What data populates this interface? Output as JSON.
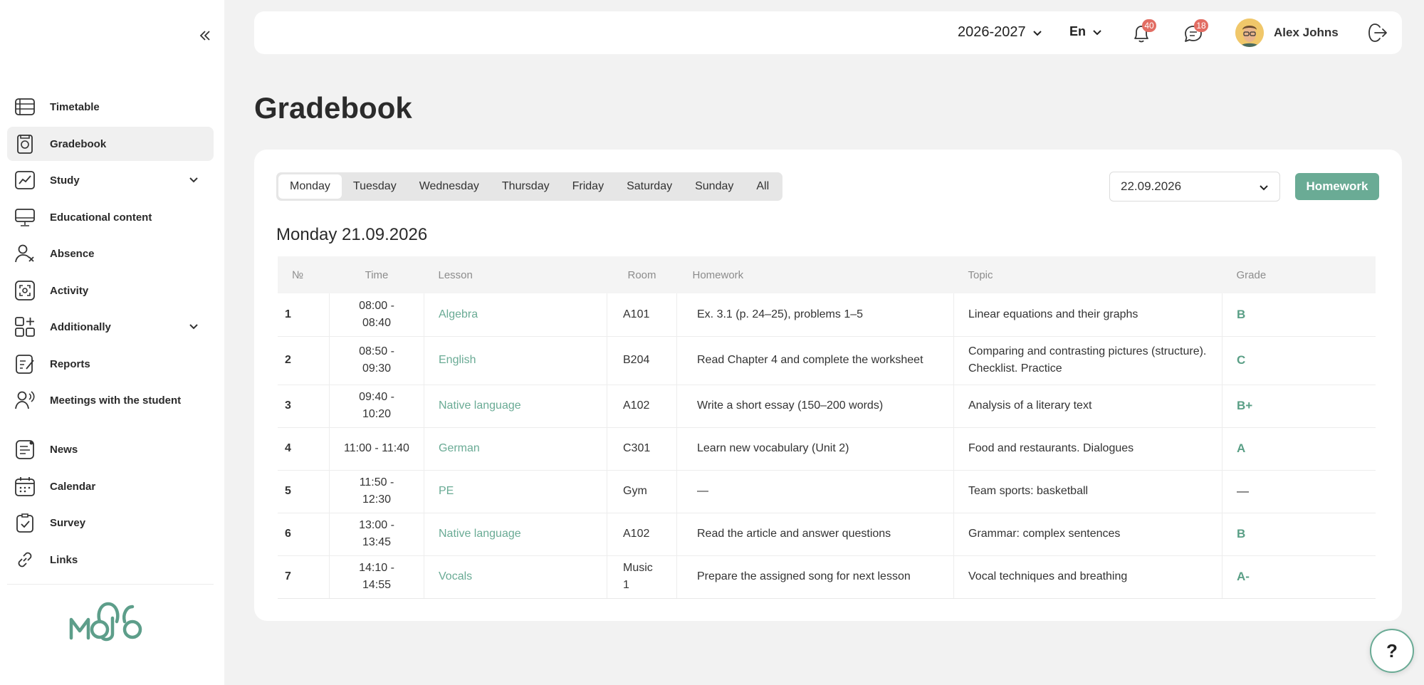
{
  "sidebar": {
    "collapse_icon": "double-chevron-left",
    "items": [
      {
        "label": "Timetable",
        "icon": "timetable-icon",
        "active": false
      },
      {
        "label": "Gradebook",
        "icon": "gradebook-icon",
        "active": true
      },
      {
        "label": "Study",
        "icon": "study-icon",
        "active": false,
        "expandable": true
      },
      {
        "label": "Educational content",
        "icon": "monitor-icon",
        "active": false
      },
      {
        "label": "Absence",
        "icon": "user-x-icon",
        "active": false
      },
      {
        "label": "Activity",
        "icon": "activity-icon",
        "active": false
      },
      {
        "label": "Additionally",
        "icon": "grid-plus-icon",
        "active": false,
        "expandable": true
      },
      {
        "label": "Reports",
        "icon": "reports-icon",
        "active": false
      },
      {
        "label": "Meetings with the student",
        "icon": "meetings-icon",
        "active": false
      },
      {
        "label": "News",
        "icon": "news-icon",
        "active": false
      },
      {
        "label": "Calendar",
        "icon": "calendar-icon",
        "active": false
      },
      {
        "label": "Survey",
        "icon": "survey-icon",
        "active": false
      },
      {
        "label": "Links",
        "icon": "link-icon",
        "active": false
      }
    ],
    "logo_text": "MOJO"
  },
  "topbar": {
    "year": "2026-2027",
    "language": "En",
    "notifications_count": "40",
    "messages_count": "18",
    "user_name": "Alex Johns"
  },
  "page": {
    "title": "Gradebook"
  },
  "filters": {
    "tabs": [
      "Monday",
      "Tuesday",
      "Wednesday",
      "Thursday",
      "Friday",
      "Saturday",
      "Sunday",
      "All"
    ],
    "active_tab": "Monday",
    "date": "22.09.2026",
    "homework_button": "Homework"
  },
  "day_heading": "Monday 21.09.2026",
  "table": {
    "headers": [
      "№",
      "Time",
      "Lesson",
      "Room",
      "Homework",
      "Topic",
      "Grade"
    ],
    "rows": [
      {
        "num": "1",
        "time": "08:00 - 08:40",
        "lesson": "Algebra",
        "room": "A101",
        "homework": "Ex. 3.1 (p. 24–25), problems 1–5",
        "topic": "Linear equations and their graphs",
        "grade": "B"
      },
      {
        "num": "2",
        "time": "08:50 - 09:30",
        "lesson": "English",
        "room": "B204",
        "homework": "Read Chapter 4 and complete the worksheet",
        "topic": "Comparing and contrasting pictures (structure). Checklist. Practice",
        "grade": "C"
      },
      {
        "num": "3",
        "time": "09:40 - 10:20",
        "lesson": "Native language",
        "room": "A102",
        "homework": "Write a short essay (150–200 words)",
        "topic": "Analysis of a literary text",
        "grade": "B+"
      },
      {
        "num": "4",
        "time": "11:00 - 11:40",
        "lesson": "German",
        "room": "C301",
        "homework": "Learn new vocabulary (Unit 2)",
        "topic": "Food and restaurants. Dialogues",
        "grade": "A"
      },
      {
        "num": "5",
        "time": "11:50 - 12:30",
        "lesson": "PE",
        "room": "Gym",
        "homework": "—",
        "topic": "Team sports: basketball",
        "grade": "—"
      },
      {
        "num": "6",
        "time": "13:00 - 13:45",
        "lesson": "Native language",
        "room": "A102",
        "homework": "Read the article and answer questions",
        "topic": "Grammar: complex sentences",
        "grade": "B"
      },
      {
        "num": "7",
        "time": "14:10 - 14:55",
        "lesson": "Vocals",
        "room": "Music 1",
        "homework": "Prepare the assigned song for next lesson",
        "topic": "Vocal techniques and breathing",
        "grade": "A-"
      }
    ]
  },
  "help": {
    "label": "?"
  },
  "colors": {
    "accent": "#6aab95",
    "badge": "#e26d63",
    "background": "#f2f2f2"
  }
}
